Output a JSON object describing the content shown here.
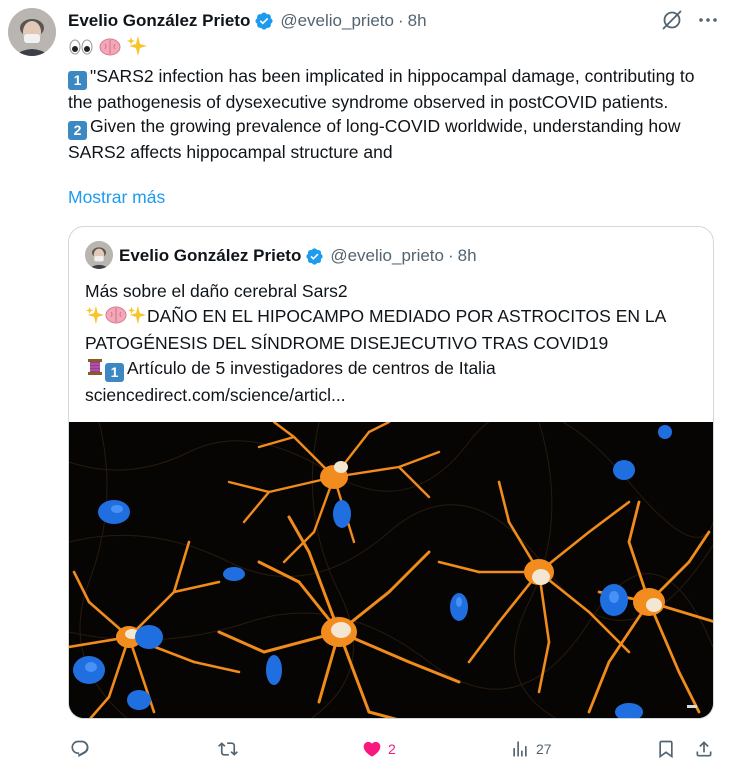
{
  "tweet": {
    "author_name": "Evelio González Prieto",
    "handle": "@evelio_prieto",
    "separator": "·",
    "time": "8h",
    "text_lines": [
      "\"SARS2 infection has been implicated in hippocampal damage, contributing to the pathogenesis of dysexecutive syndrome observed in postCOVID patients.",
      "Given the growing prevalence of long-COVID worldwide, understanding how SARS2 affects hippocampal structure and"
    ],
    "keycap_1": "1",
    "keycap_2": "2",
    "show_more": "Mostrar más"
  },
  "quote": {
    "author_name": "Evelio González Prieto",
    "handle": "@evelio_prieto",
    "separator": "·",
    "time": "8h",
    "line1": "Más sobre el daño cerebral Sars2",
    "line2": "DAÑO EN EL HIPOCAMPO MEDIADO POR ASTROCITOS EN LA PATOGÉNESIS DEL SÍNDROME DISEJECUTIVO TRAS COVID19",
    "line3": "Artículo de 5 investigadores de centros de Italia",
    "keycap_1": "1",
    "link": "sciencedirect.com/science/articl..."
  },
  "actions": {
    "reply_count": "",
    "retweet_count": "",
    "like_count": "2",
    "views_count": "27"
  },
  "icons": {
    "verified": "verified-badge-icon",
    "grok": "grok-icon",
    "more": "more-icon",
    "reply": "reply-icon",
    "retweet": "retweet-icon",
    "like": "heart-icon",
    "views": "views-icon",
    "bookmark": "bookmark-icon",
    "share": "share-icon"
  },
  "colors": {
    "accent": "#1d9bf0",
    "like": "#f91880",
    "secondary_text": "#536471",
    "keycap": "#3b88c3"
  }
}
